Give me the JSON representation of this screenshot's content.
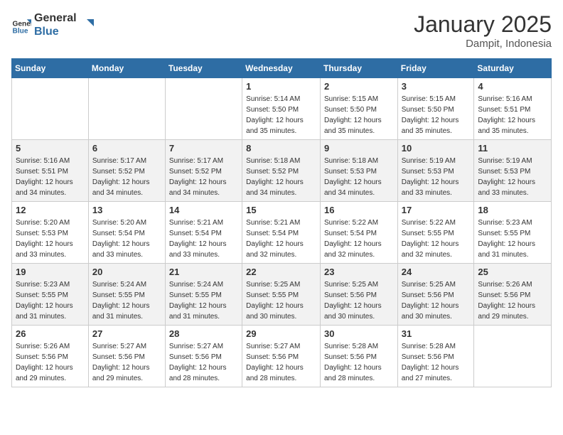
{
  "logo": {
    "line1": "General",
    "line2": "Blue"
  },
  "title": "January 2025",
  "location": "Dampit, Indonesia",
  "days_of_week": [
    "Sunday",
    "Monday",
    "Tuesday",
    "Wednesday",
    "Thursday",
    "Friday",
    "Saturday"
  ],
  "weeks": [
    [
      {
        "day": "",
        "sunrise": "",
        "sunset": "",
        "daylight": ""
      },
      {
        "day": "",
        "sunrise": "",
        "sunset": "",
        "daylight": ""
      },
      {
        "day": "",
        "sunrise": "",
        "sunset": "",
        "daylight": ""
      },
      {
        "day": "1",
        "sunrise": "5:14 AM",
        "sunset": "5:50 PM",
        "daylight": "12 hours and 35 minutes."
      },
      {
        "day": "2",
        "sunrise": "5:15 AM",
        "sunset": "5:50 PM",
        "daylight": "12 hours and 35 minutes."
      },
      {
        "day": "3",
        "sunrise": "5:15 AM",
        "sunset": "5:50 PM",
        "daylight": "12 hours and 35 minutes."
      },
      {
        "day": "4",
        "sunrise": "5:16 AM",
        "sunset": "5:51 PM",
        "daylight": "12 hours and 35 minutes."
      }
    ],
    [
      {
        "day": "5",
        "sunrise": "5:16 AM",
        "sunset": "5:51 PM",
        "daylight": "12 hours and 34 minutes."
      },
      {
        "day": "6",
        "sunrise": "5:17 AM",
        "sunset": "5:52 PM",
        "daylight": "12 hours and 34 minutes."
      },
      {
        "day": "7",
        "sunrise": "5:17 AM",
        "sunset": "5:52 PM",
        "daylight": "12 hours and 34 minutes."
      },
      {
        "day": "8",
        "sunrise": "5:18 AM",
        "sunset": "5:52 PM",
        "daylight": "12 hours and 34 minutes."
      },
      {
        "day": "9",
        "sunrise": "5:18 AM",
        "sunset": "5:53 PM",
        "daylight": "12 hours and 34 minutes."
      },
      {
        "day": "10",
        "sunrise": "5:19 AM",
        "sunset": "5:53 PM",
        "daylight": "12 hours and 33 minutes."
      },
      {
        "day": "11",
        "sunrise": "5:19 AM",
        "sunset": "5:53 PM",
        "daylight": "12 hours and 33 minutes."
      }
    ],
    [
      {
        "day": "12",
        "sunrise": "5:20 AM",
        "sunset": "5:53 PM",
        "daylight": "12 hours and 33 minutes."
      },
      {
        "day": "13",
        "sunrise": "5:20 AM",
        "sunset": "5:54 PM",
        "daylight": "12 hours and 33 minutes."
      },
      {
        "day": "14",
        "sunrise": "5:21 AM",
        "sunset": "5:54 PM",
        "daylight": "12 hours and 33 minutes."
      },
      {
        "day": "15",
        "sunrise": "5:21 AM",
        "sunset": "5:54 PM",
        "daylight": "12 hours and 32 minutes."
      },
      {
        "day": "16",
        "sunrise": "5:22 AM",
        "sunset": "5:54 PM",
        "daylight": "12 hours and 32 minutes."
      },
      {
        "day": "17",
        "sunrise": "5:22 AM",
        "sunset": "5:55 PM",
        "daylight": "12 hours and 32 minutes."
      },
      {
        "day": "18",
        "sunrise": "5:23 AM",
        "sunset": "5:55 PM",
        "daylight": "12 hours and 31 minutes."
      }
    ],
    [
      {
        "day": "19",
        "sunrise": "5:23 AM",
        "sunset": "5:55 PM",
        "daylight": "12 hours and 31 minutes."
      },
      {
        "day": "20",
        "sunrise": "5:24 AM",
        "sunset": "5:55 PM",
        "daylight": "12 hours and 31 minutes."
      },
      {
        "day": "21",
        "sunrise": "5:24 AM",
        "sunset": "5:55 PM",
        "daylight": "12 hours and 31 minutes."
      },
      {
        "day": "22",
        "sunrise": "5:25 AM",
        "sunset": "5:55 PM",
        "daylight": "12 hours and 30 minutes."
      },
      {
        "day": "23",
        "sunrise": "5:25 AM",
        "sunset": "5:56 PM",
        "daylight": "12 hours and 30 minutes."
      },
      {
        "day": "24",
        "sunrise": "5:25 AM",
        "sunset": "5:56 PM",
        "daylight": "12 hours and 30 minutes."
      },
      {
        "day": "25",
        "sunrise": "5:26 AM",
        "sunset": "5:56 PM",
        "daylight": "12 hours and 29 minutes."
      }
    ],
    [
      {
        "day": "26",
        "sunrise": "5:26 AM",
        "sunset": "5:56 PM",
        "daylight": "12 hours and 29 minutes."
      },
      {
        "day": "27",
        "sunrise": "5:27 AM",
        "sunset": "5:56 PM",
        "daylight": "12 hours and 29 minutes."
      },
      {
        "day": "28",
        "sunrise": "5:27 AM",
        "sunset": "5:56 PM",
        "daylight": "12 hours and 28 minutes."
      },
      {
        "day": "29",
        "sunrise": "5:27 AM",
        "sunset": "5:56 PM",
        "daylight": "12 hours and 28 minutes."
      },
      {
        "day": "30",
        "sunrise": "5:28 AM",
        "sunset": "5:56 PM",
        "daylight": "12 hours and 28 minutes."
      },
      {
        "day": "31",
        "sunrise": "5:28 AM",
        "sunset": "5:56 PM",
        "daylight": "12 hours and 27 minutes."
      },
      {
        "day": "",
        "sunrise": "",
        "sunset": "",
        "daylight": ""
      }
    ]
  ]
}
